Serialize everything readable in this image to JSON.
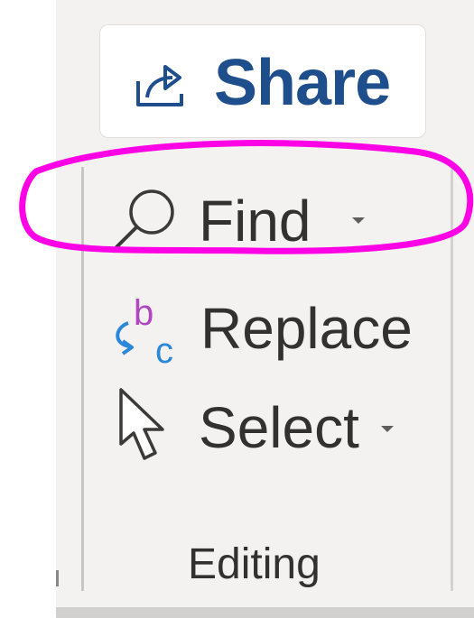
{
  "share": {
    "label": "Share",
    "icon": "share-icon"
  },
  "editing": {
    "find": {
      "label": "Find",
      "icon": "magnifier-icon"
    },
    "replace": {
      "label": "Replace",
      "icon": "replace-icon",
      "icon_letters": [
        "b",
        "c"
      ]
    },
    "select": {
      "label": "Select",
      "icon": "pointer-icon"
    },
    "group_label": "Editing"
  },
  "colors": {
    "accent": "#1e4e8c",
    "annotation": "#ff00e6",
    "replace_b": "#b146c2",
    "replace_c": "#2b88d8"
  }
}
